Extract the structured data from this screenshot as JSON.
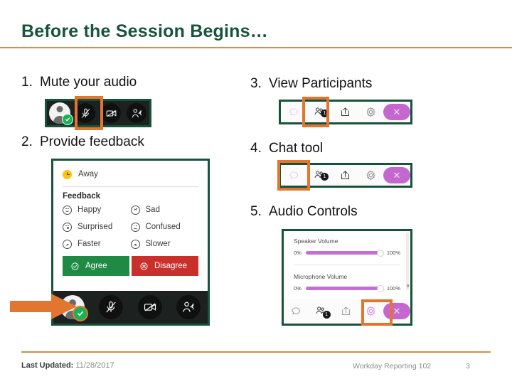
{
  "slide": {
    "title": "Before the Session Begins…",
    "accent_orange": "#d98b47",
    "title_green": "#17543c",
    "frame_green": "#15533a",
    "highlight_orange": "#e2752f"
  },
  "steps": [
    {
      "num": "1.",
      "label": "Mute your audio"
    },
    {
      "num": "2.",
      "label": "Provide feedback"
    },
    {
      "num": "3.",
      "label": "View Participants"
    },
    {
      "num": "4.",
      "label": "Chat tool"
    },
    {
      "num": "5.",
      "label": "Audio Controls"
    }
  ],
  "mute_toolbar": {
    "icons": [
      "avatar-icon",
      "microphone-muted-icon",
      "camera-off-icon",
      "raise-hand-icon"
    ],
    "highlighted": "microphone-muted-icon"
  },
  "feedback_panel": {
    "status": {
      "icon": "clock-icon",
      "label": "Away"
    },
    "section_title": "Feedback",
    "options": [
      {
        "icon": "happy-face-icon",
        "label": "Happy"
      },
      {
        "icon": "sad-face-icon",
        "label": "Sad"
      },
      {
        "icon": "surprised-face-icon",
        "label": "Surprised"
      },
      {
        "icon": "confused-face-icon",
        "label": "Confused"
      },
      {
        "icon": "faster-icon",
        "label": "Faster"
      },
      {
        "icon": "slower-icon",
        "label": "Slower"
      }
    ],
    "agree_label": "Agree",
    "disagree_label": "Disagree",
    "agree_color": "#1e8a43",
    "disagree_color": "#c9302c",
    "toolbar_icons": [
      "avatar-icon",
      "microphone-muted-icon",
      "camera-off-icon",
      "raise-hand-icon"
    ],
    "arrow_points_to": "avatar-icon"
  },
  "participants_toolbar": {
    "icons": [
      "chat-icon",
      "participants-icon",
      "share-icon",
      "gear-icon",
      "close-icon"
    ],
    "participant_count": "1",
    "highlighted": "participants-icon",
    "close_color": "#c468cf"
  },
  "chat_toolbar": {
    "icons": [
      "chat-icon",
      "participants-icon",
      "share-icon",
      "gear-icon",
      "close-icon"
    ],
    "participant_count": "1",
    "highlighted": "chat-icon"
  },
  "audio_panel": {
    "speaker": {
      "label": "Speaker Volume",
      "min": "0%",
      "max": "100%",
      "value": 96
    },
    "microphone": {
      "label": "Microphone Volume",
      "min": "0%",
      "max": "100%",
      "value": 96
    },
    "slider_color": "#c46fd4",
    "toolbar_icons": [
      "chat-icon",
      "participants-icon",
      "share-icon",
      "gear-icon",
      "close-icon"
    ],
    "participant_count": "1",
    "highlighted": "gear-icon"
  },
  "footer": {
    "updated_label": "Last Updated:",
    "updated_date": "11/28/2017",
    "deck_name": "Workday Reporting 102",
    "page_number": "3"
  }
}
